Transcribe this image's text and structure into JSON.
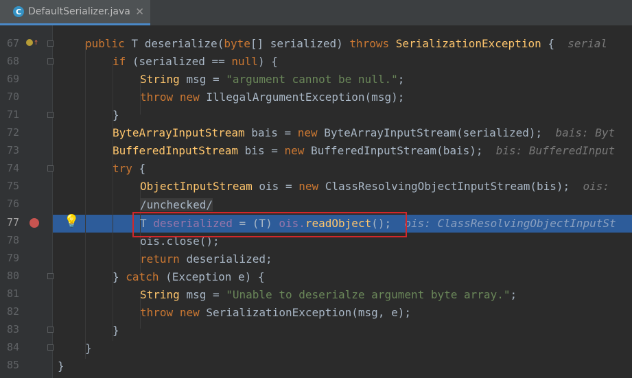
{
  "tab": {
    "icon_letter": "C",
    "filename": "DefaultSerializer.java",
    "close": "✕"
  },
  "gutter": {
    "lines": [
      "67",
      "68",
      "69",
      "70",
      "71",
      "72",
      "73",
      "74",
      "75",
      "76",
      "77",
      "78",
      "79",
      "80",
      "81",
      "82",
      "83",
      "84",
      "85"
    ]
  },
  "code": {
    "l67": {
      "kw1": "public",
      "t": "T",
      "m": "deserialize",
      "p1": "(",
      "kw2": "byte",
      "p2": "[] serialized)",
      "kw3": "throws",
      "cls": "SerializationException",
      "p3": "{",
      "hint": "serial"
    },
    "l68": {
      "kw": "if",
      "rest1": "(serialized ==",
      "kw2": "null",
      "rest2": ") {"
    },
    "l69": {
      "t": "String",
      "v": "msg =",
      "s": "\"argument cannot be null.\"",
      "e": ";"
    },
    "l70": {
      "kw1": "throw",
      "kw2": "new",
      "rest": "IllegalArgumentException(msg);"
    },
    "l71": {
      "rest": "}"
    },
    "l72": {
      "t": "ByteArrayInputStream",
      "v": "bais =",
      "kw": "new",
      "rest": "ByteArrayInputStream(serialized);",
      "hint": "bais: Byt"
    },
    "l73": {
      "t": "BufferedInputStream",
      "v": "bis =",
      "kw": "new",
      "rest": "BufferedInputStream(bais);",
      "hint": "bis: BufferedInput"
    },
    "l74": {
      "kw": "try",
      "rest": "{"
    },
    "l75": {
      "t": "ObjectInputStream",
      "v": "ois =",
      "kw": "new",
      "rest": "ClassResolvingObjectInputStream(bis);",
      "hint": "ois:"
    },
    "l76": {
      "rest": "/unchecked/"
    },
    "l77": {
      "t": "T",
      "v": "deserialized",
      "eq": "=",
      "cast": "(T)",
      "obj": "ois.",
      "m": "readObject",
      "end": "();",
      "hint": "ois: ClassResolvingObjectInputSt"
    },
    "l78": {
      "rest": "ois.close();"
    },
    "l79": {
      "kw": "return",
      "rest": "deserialized;"
    },
    "l80": {
      "p1": "}",
      "kw": "catch",
      "rest": "(Exception e) {"
    },
    "l81": {
      "t": "String",
      "v": "msg =",
      "s": "\"Unable to deserialze argument byte array.\"",
      "e": ";"
    },
    "l82": {
      "kw1": "throw",
      "kw2": "new",
      "rest": "SerializationException(msg, e);"
    },
    "l83": {
      "rest": "}"
    },
    "l84": {
      "rest": "}"
    },
    "l85": {
      "rest": "}"
    }
  },
  "colors": {
    "keyword": "#cc7832",
    "string": "#6a8759",
    "class_highlight": "#ffc66d",
    "current_line": "#2d5c9a",
    "red_box": "#d3272a"
  },
  "icons": [
    "java-class-icon",
    "close-icon",
    "override-icon",
    "breakpoint-icon",
    "lightbulb-icon",
    "fold-icon"
  ]
}
